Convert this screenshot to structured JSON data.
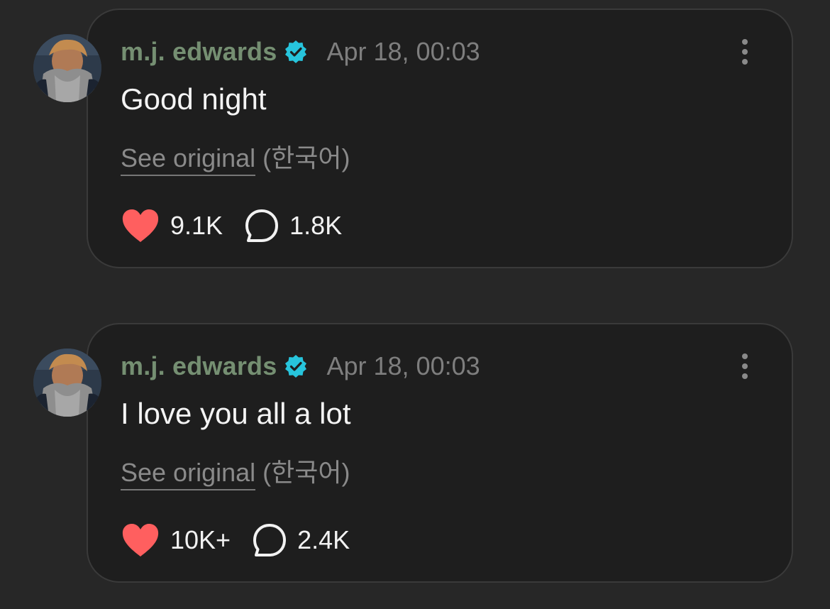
{
  "colors": {
    "background": "#272727",
    "card": "#1e1e1e",
    "author": "#758f72",
    "verified_badge": "#27c4dc",
    "heart": "#ff5f5f",
    "muted_text": "#7e7e7e"
  },
  "posts": [
    {
      "author": "m.j. edwards",
      "verified_icon": "verified-badge-icon",
      "timestamp": "Apr 18, 00:03",
      "text": "Good night",
      "see_original": "See original",
      "language": "(한국어)",
      "likes": "9.1K",
      "replies": "1.8K"
    },
    {
      "author": "m.j. edwards",
      "verified_icon": "verified-badge-icon",
      "timestamp": "Apr 18, 00:03",
      "text": "I love you all a lot",
      "see_original": "See original",
      "language": "(한국어)",
      "likes": "10K+",
      "replies": "2.4K"
    }
  ]
}
